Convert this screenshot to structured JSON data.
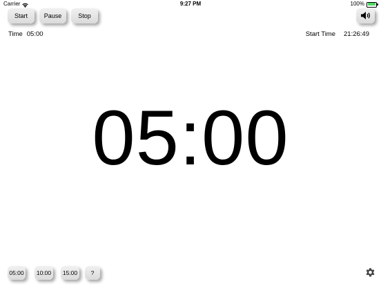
{
  "status_bar": {
    "carrier": "Carrier",
    "time": "9:27 PM",
    "battery": "100%"
  },
  "controls": {
    "start_label": "Start",
    "pause_label": "Pause",
    "stop_label": "Stop"
  },
  "info": {
    "time_label": "Time",
    "time_value": "05:00",
    "start_time_label": "Start Time",
    "start_time_value": "21:26:49"
  },
  "display": {
    "countdown": "05:00"
  },
  "presets": [
    {
      "label": "05:00"
    },
    {
      "label": "10:00"
    },
    {
      "label": "15:00"
    }
  ],
  "help_label": "?",
  "icons": {
    "sound": "speaker-icon",
    "settings": "gear-icon",
    "wifi": "wifi-icon",
    "battery": "battery-icon"
  },
  "colors": {
    "battery_fill": "#4cd964",
    "button_bg": "#e6e6e6"
  }
}
